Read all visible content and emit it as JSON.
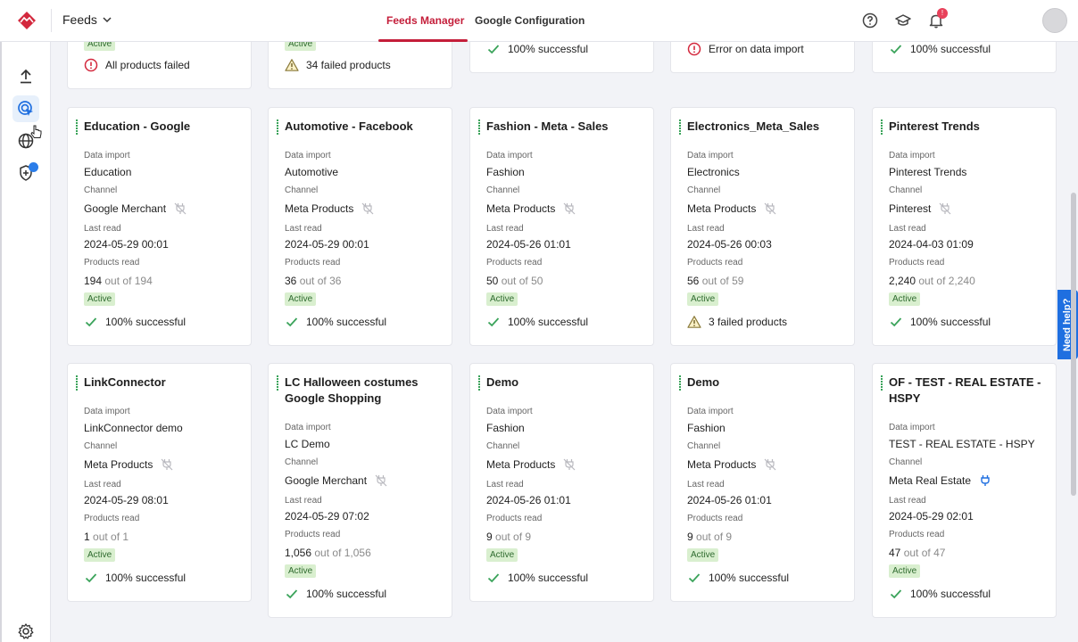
{
  "header": {
    "app_selector": "Feeds",
    "tabs": [
      {
        "label": "Feeds Manager",
        "active": true
      },
      {
        "label": "Google Configuration",
        "active": false
      }
    ],
    "notification_badge": "!",
    "accent_color": "#c41e3a"
  },
  "labels": {
    "data_import": "Data import",
    "channel": "Channel",
    "last_read": "Last read",
    "products_read": "Products read",
    "out_of": "out of"
  },
  "top_row": [
    {
      "status": "Active",
      "result": "All products failed",
      "result_icon": "error-circle-icon"
    },
    {
      "status": "Active",
      "result": "34 failed products",
      "result_icon": "warning-triangle-icon"
    },
    {
      "result": "100% successful",
      "result_icon": "check-icon"
    },
    {
      "result": "Error on data import",
      "result_icon": "error-circle-icon"
    },
    {
      "result": "100% successful",
      "result_icon": "check-icon"
    }
  ],
  "cards": [
    {
      "title": "Education - Google",
      "data_import": "Education",
      "channel": "Google Merchant",
      "channel_icon": "plug-off-icon",
      "last_read": "2024-05-29 00:01",
      "read": "194",
      "total": "194",
      "status": "Active",
      "result": "100% successful",
      "result_icon": "check-icon"
    },
    {
      "title": "Automotive - Facebook",
      "data_import": "Automotive",
      "channel": "Meta Products",
      "channel_icon": "plug-off-icon",
      "last_read": "2024-05-29 00:01",
      "read": "36",
      "total": "36",
      "status": "Active",
      "result": "100% successful",
      "result_icon": "check-icon"
    },
    {
      "title": "Fashion - Meta - Sales",
      "data_import": "Fashion",
      "channel": "Meta Products",
      "channel_icon": "plug-off-icon",
      "last_read": "2024-05-26 01:01",
      "read": "50",
      "total": "50",
      "status": "Active",
      "result": "100% successful",
      "result_icon": "check-icon"
    },
    {
      "title": "Electronics_Meta_Sales",
      "data_import": "Electronics",
      "channel": "Meta Products",
      "channel_icon": "plug-off-icon",
      "last_read": "2024-05-26 00:03",
      "read": "56",
      "total": "59",
      "status": "Active",
      "result": "3 failed products",
      "result_icon": "warning-triangle-icon"
    },
    {
      "title": "Pinterest Trends",
      "data_import": "Pinterest Trends",
      "channel": "Pinterest",
      "channel_icon": "plug-off-icon",
      "last_read": "2024-04-03 01:09",
      "read": "2,240",
      "total": "2,240",
      "status": "Active",
      "result": "100% successful",
      "result_icon": "check-icon"
    },
    {
      "title": "LinkConnector",
      "data_import": "LinkConnector demo",
      "channel": "Meta Products",
      "channel_icon": "plug-off-icon",
      "last_read": "2024-05-29 08:01",
      "read": "1",
      "total": "1",
      "status": "Active",
      "result": "100% successful",
      "result_icon": "check-icon"
    },
    {
      "title": "LC Halloween costumes Google Shopping",
      "data_import": "LC Demo",
      "channel": "Google Merchant",
      "channel_icon": "plug-off-icon",
      "last_read": "2024-05-29 07:02",
      "read": "1,056",
      "total": "1,056",
      "status": "Active",
      "result": "100% successful",
      "result_icon": "check-icon"
    },
    {
      "title": "Demo",
      "data_import": "Fashion",
      "channel": "Meta Products",
      "channel_icon": "plug-off-icon",
      "last_read": "2024-05-26 01:01",
      "read": "9",
      "total": "9",
      "status": "Active",
      "result": "100% successful",
      "result_icon": "check-icon"
    },
    {
      "title": "Demo",
      "data_import": "Fashion",
      "channel": "Meta Products",
      "channel_icon": "plug-off-icon",
      "last_read": "2024-05-26 01:01",
      "read": "9",
      "total": "9",
      "status": "Active",
      "result": "100% successful",
      "result_icon": "check-icon"
    },
    {
      "title": "OF - TEST - REAL ESTATE - HSPY",
      "data_import": "TEST - REAL ESTATE - HSPY",
      "channel": "Meta Real Estate",
      "channel_icon": "plug-on-icon",
      "last_read": "2024-05-29 02:01",
      "read": "47",
      "total": "47",
      "status": "Active",
      "result": "100% successful",
      "result_icon": "check-icon"
    }
  ],
  "need_help": "Need help?"
}
